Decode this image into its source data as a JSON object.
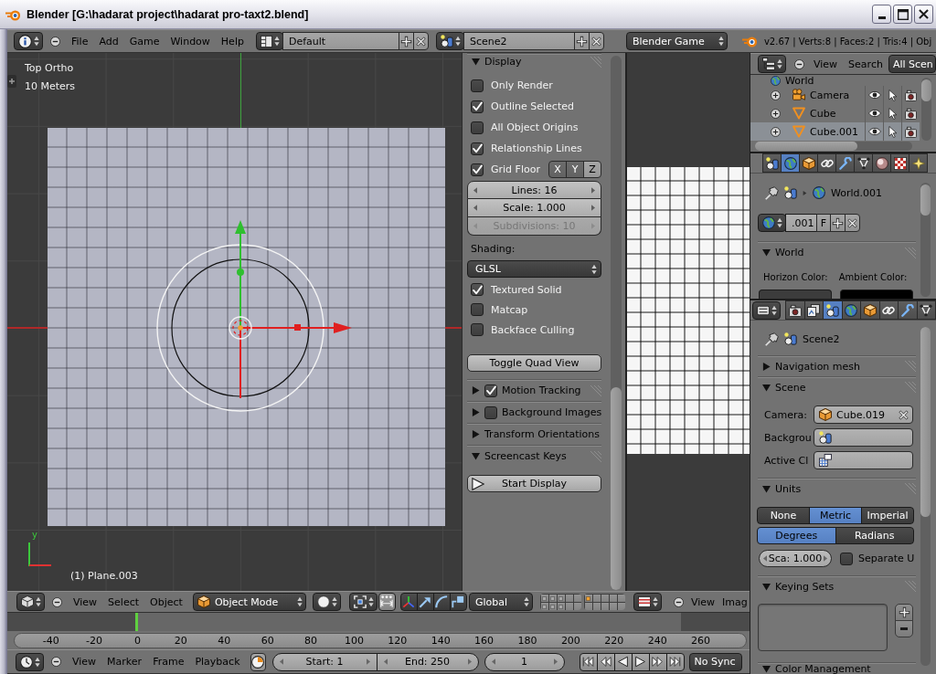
{
  "window": {
    "title": "Blender [G:\\hadarat project\\hadarat pro-taxt2.blend]"
  },
  "info_header": {
    "menus": [
      "File",
      "Add",
      "Game",
      "Window",
      "Help"
    ],
    "screen": "Default",
    "scene": "Scene2",
    "engine": "Blender Game",
    "stats": "v2.67 | Verts:8 | Faces:2 | Tris:4 | Obj"
  },
  "viewport": {
    "view": "Top Ortho",
    "scale": "10 Meters",
    "object": "(1) Plane.003",
    "axis_label": "y"
  },
  "view_panel": {
    "display": {
      "title": "Display",
      "expanded": true,
      "options": [
        {
          "label": "Only Render",
          "checked": false
        },
        {
          "label": "Outline Selected",
          "checked": true
        },
        {
          "label": "All Object Origins",
          "checked": false
        },
        {
          "label": "Relationship Lines",
          "checked": true
        }
      ],
      "grid_floor": {
        "label": "Grid Floor",
        "checked": true,
        "axes": [
          {
            "label": "X",
            "on": true
          },
          {
            "label": "Y",
            "on": true
          },
          {
            "label": "Z",
            "on": false
          }
        ]
      },
      "fields": [
        {
          "label": "Lines: 16",
          "disabled": false
        },
        {
          "label": "Scale: 1.000",
          "disabled": false
        },
        {
          "label": "Subdivisions: 10",
          "disabled": true
        }
      ],
      "shading_label": "Shading:",
      "shading": "GLSL",
      "shading_options": [
        {
          "label": "Textured Solid",
          "checked": true
        },
        {
          "label": "Matcap",
          "checked": false
        },
        {
          "label": "Backface Culling",
          "checked": false
        }
      ],
      "button": "Toggle Quad View"
    },
    "subpanels": [
      {
        "title": "Motion Tracking",
        "expanded": false,
        "checked": true
      },
      {
        "title": "Background Images",
        "expanded": false,
        "checked": false
      },
      {
        "title": "Transform Orientations",
        "expanded": false
      }
    ],
    "screencast": {
      "title": "Screencast Keys",
      "expanded": true,
      "button": "Start Display"
    }
  },
  "view3d_header": {
    "menus": [
      "View",
      "Select",
      "Object"
    ],
    "mode": "Object Mode",
    "orientation": "Global",
    "layers": [
      {
        "used": true,
        "active": false
      },
      {
        "used": true,
        "active": false
      },
      {
        "used": true,
        "active": false
      },
      {
        "used": false,
        "active": false
      },
      {
        "used": false,
        "active": false
      },
      {
        "used": true,
        "active": false
      },
      {
        "used": true,
        "active": false
      },
      {
        "used": true,
        "active": false
      },
      {
        "used": false,
        "active": false
      },
      {
        "used": false,
        "active": false
      },
      {
        "used": true,
        "active": true
      },
      {
        "used": false,
        "active": false
      },
      {
        "used": false,
        "active": false
      },
      {
        "used": false,
        "active": false
      },
      {
        "used": false,
        "active": false
      },
      {
        "used": false,
        "active": false
      },
      {
        "used": false,
        "active": false
      },
      {
        "used": false,
        "active": false
      },
      {
        "used": false,
        "active": false
      },
      {
        "used": false,
        "active": false
      }
    ]
  },
  "image_header": {
    "menus": [
      "View",
      "Imag"
    ]
  },
  "timeline": {
    "ticks": [
      "-40",
      "-20",
      "0",
      "20",
      "40",
      "60",
      "80",
      "100",
      "120",
      "140",
      "160",
      "180",
      "200",
      "220",
      "240",
      "260"
    ]
  },
  "timeline_header": {
    "menus": [
      "View",
      "Marker",
      "Frame",
      "Playback"
    ],
    "start": "Start: 1",
    "end": "End: 250",
    "frame": "1",
    "sync": "No Sync"
  },
  "outliner": {
    "menus": [
      "View",
      "Search"
    ],
    "filter": "All Scen",
    "rows": [
      {
        "name": "World",
        "kind": "world",
        "selected": false
      },
      {
        "name": "Camera",
        "kind": "camera",
        "selected": false
      },
      {
        "name": "Cube",
        "kind": "mesh",
        "selected": false
      },
      {
        "name": "Cube.001",
        "kind": "mesh",
        "selected": true
      }
    ]
  },
  "world_properties": {
    "tabs": [
      {
        "kind": "scene",
        "selected": false
      },
      {
        "kind": "world",
        "selected": true
      },
      {
        "kind": "object",
        "selected": false
      },
      {
        "kind": "constraints",
        "selected": false
      },
      {
        "kind": "modifiers",
        "selected": false
      },
      {
        "kind": "data",
        "selected": false
      },
      {
        "kind": "material",
        "selected": false
      },
      {
        "kind": "texture",
        "selected": false
      },
      {
        "kind": "particles",
        "selected": false
      }
    ],
    "path": "World.001",
    "datablock": {
      "name": ".001",
      "fake_user": "F"
    },
    "panel": {
      "title": "World",
      "expanded": true,
      "colors": [
        {
          "label": "Horizon Color:",
          "color": "#3c3c3c"
        },
        {
          "label": "Ambient Color:",
          "color": "#000000"
        }
      ]
    }
  },
  "scene_properties": {
    "tabs": [
      {
        "kind": "render",
        "selected": false
      },
      {
        "kind": "render_layers",
        "selected": false
      },
      {
        "kind": "scene",
        "selected": true
      },
      {
        "kind": "world",
        "selected": false
      },
      {
        "kind": "object",
        "selected": false
      },
      {
        "kind": "constraints",
        "selected": false
      },
      {
        "kind": "modifiers",
        "selected": false
      },
      {
        "kind": "data",
        "selected": false
      }
    ],
    "path": "Scene2",
    "panels": [
      {
        "kind": "navmesh",
        "title": "Navigation mesh",
        "expanded": false
      },
      {
        "kind": "scene",
        "title": "Scene",
        "expanded": true,
        "fields": [
          {
            "label": "Camera:",
            "kind": "object",
            "value": "Cube.019"
          },
          {
            "label": "Backgrou",
            "kind": "scene"
          },
          {
            "label": "Active Cl",
            "kind": "clip"
          }
        ]
      },
      {
        "kind": "units",
        "title": "Units",
        "expanded": true,
        "systems": [
          {
            "label": "None",
            "selected": false
          },
          {
            "label": "Metric",
            "selected": true
          },
          {
            "label": "Imperial",
            "selected": false
          }
        ],
        "rotation": [
          {
            "label": "Degrees",
            "selected": true
          },
          {
            "label": "Radians",
            "selected": false
          }
        ],
        "scale": "Sca: 1.000",
        "separate": {
          "label": "Separate U",
          "checked": false
        }
      },
      {
        "kind": "keying",
        "title": "Keying Sets",
        "expanded": true
      },
      {
        "kind": "color",
        "title": "Color Management",
        "expanded": true
      }
    ]
  }
}
